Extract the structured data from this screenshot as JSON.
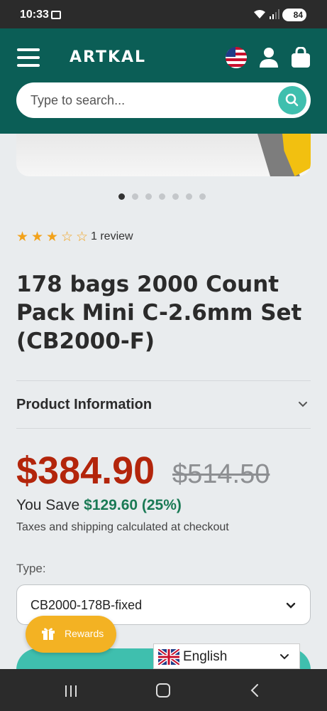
{
  "status_bar": {
    "time": "10:33",
    "battery": "84"
  },
  "header": {
    "logo": "ARTKAL",
    "colors": {
      "background": "#0b5e56",
      "accent": "#3fbfae"
    }
  },
  "search": {
    "placeholder": "Type to search..."
  },
  "carousel": {
    "dot_count": 7,
    "active_index": 0
  },
  "rating": {
    "stars_filled": 3,
    "stars_total": 5,
    "review_text": "1 review"
  },
  "product": {
    "title": "178 bags 2000 Count Pack Mini C-2.6mm Set (CB2000-F)",
    "info_label": "Product Information",
    "price": "$384.90",
    "compare_price": "$514.50",
    "save_label": "You Save",
    "save_amount": "$129.60 (25%)",
    "tax_note": "Taxes and shipping calculated at checkout",
    "type_label": "Type:",
    "type_value": "CB2000-178B-fixed"
  },
  "rewards": {
    "label": "Rewards"
  },
  "language": {
    "label": "English"
  },
  "icons": [
    "hamburger-icon",
    "us-flag-icon",
    "user-icon",
    "cart-icon",
    "search-icon",
    "chevron-down-icon",
    "gift-icon",
    "uk-flag-icon"
  ]
}
